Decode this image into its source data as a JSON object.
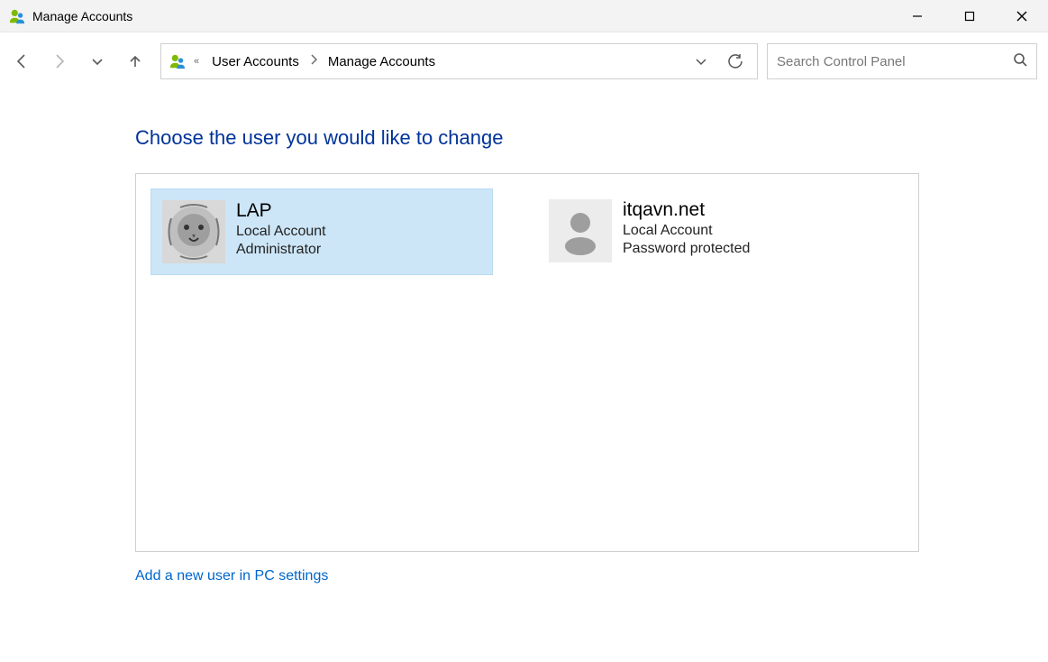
{
  "window": {
    "title": "Manage Accounts"
  },
  "breadcrumb": {
    "items": [
      "User Accounts",
      "Manage Accounts"
    ]
  },
  "search": {
    "placeholder": "Search Control Panel",
    "value": ""
  },
  "page": {
    "heading": "Choose the user you would like to change",
    "add_user_link": "Add a new user in PC settings"
  },
  "accounts": [
    {
      "name": "LAP",
      "line1": "Local Account",
      "line2": "Administrator",
      "selected": true,
      "avatar": "lion"
    },
    {
      "name": "itqavn.net",
      "line1": "Local Account",
      "line2": "Password protected",
      "selected": false,
      "avatar": "default"
    }
  ]
}
